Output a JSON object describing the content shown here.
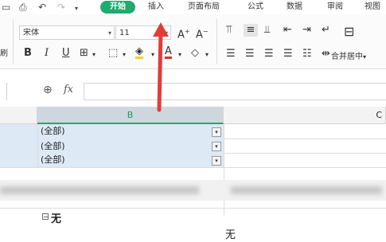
{
  "tabs": {
    "home": "开始",
    "insert": "插入",
    "page_layout": "页面布局",
    "formulas": "公式",
    "data": "数据",
    "review": "审阅",
    "view": "视图"
  },
  "ribbon": {
    "font_name": "宋体",
    "font_size": "11",
    "merge_center": "合并居中",
    "merge_center_arrow": "▾"
  },
  "formula_bar": {
    "fx_label": "fx",
    "value": ""
  },
  "grid": {
    "col_b": "B",
    "col_c": "C",
    "filter_rows": [
      "(全部)",
      "(全部)",
      "(全部)"
    ],
    "group_label": "无",
    "value_cell": "无"
  },
  "colors": {
    "accent": "#1faa6e",
    "selected_col_header": "#cfd7de",
    "filter_fill": "#dde9f5",
    "arrow": "#e23b3b"
  }
}
